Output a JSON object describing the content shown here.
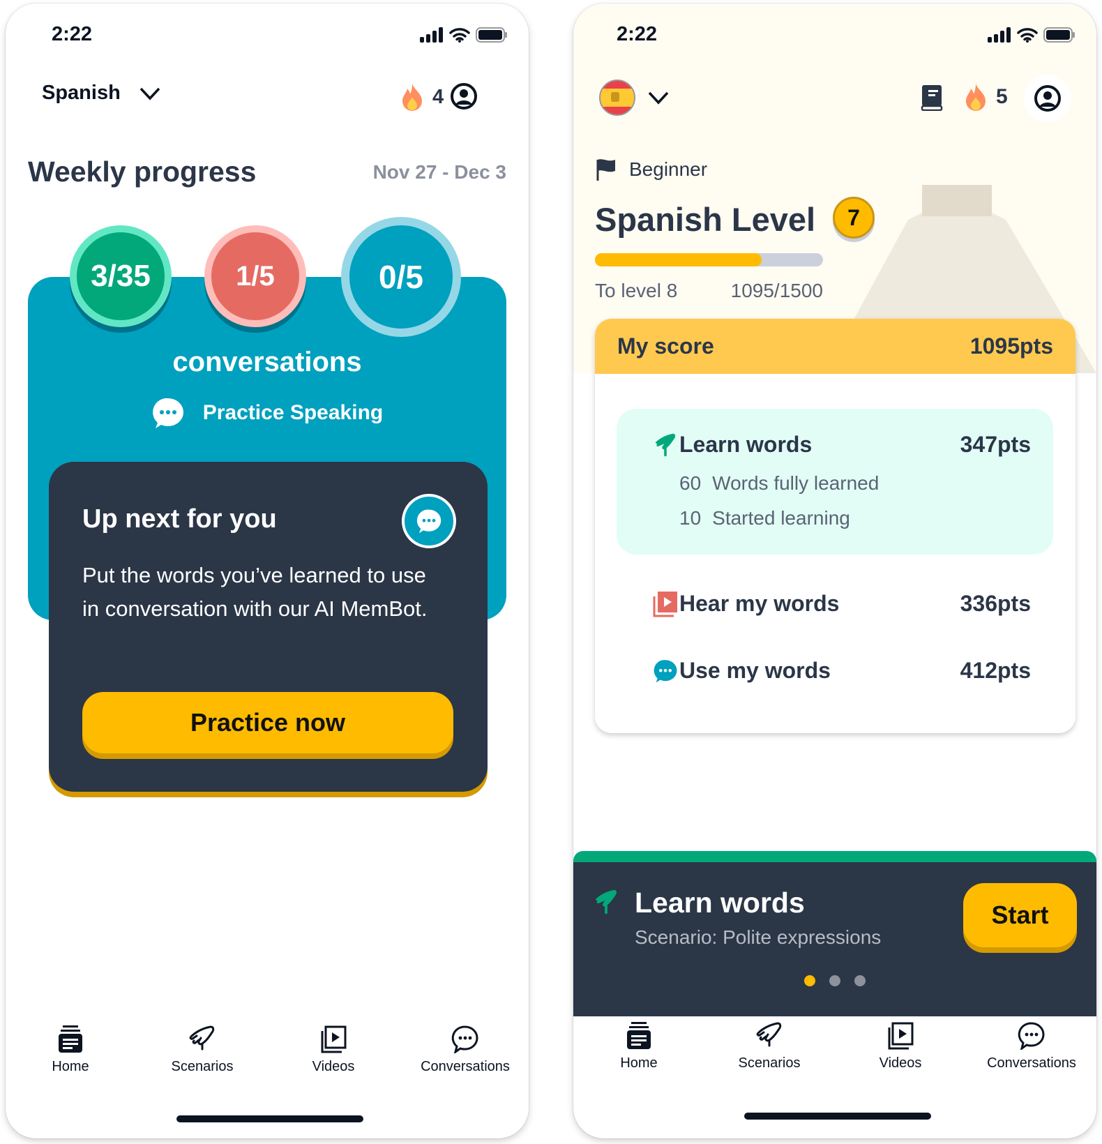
{
  "status": {
    "time": "2:22"
  },
  "left": {
    "language": "Spanish",
    "streak": "4",
    "title": "Weekly progress",
    "date_range": "Nov 27 - Dec 3",
    "circles": [
      {
        "value": "3/35",
        "color": "#03a87a"
      },
      {
        "value": "1/5",
        "color": "#e56b62"
      },
      {
        "value": "0/5",
        "color": "#00a0bf"
      }
    ],
    "circle_label": "conversations",
    "practice_label": "Practice Speaking",
    "up_next": {
      "title": "Up next for you",
      "body": "Put the words you’ve learned to use in conversation with our AI MemBot.",
      "button": "Practice now"
    }
  },
  "right": {
    "streak": "5",
    "difficulty": "Beginner",
    "level_title": "Spanish Level",
    "level": "7",
    "progress": {
      "label": "To level 8",
      "value": "1095/1500",
      "current": 1095,
      "target": 1500
    },
    "score": {
      "label": "My score",
      "value": "1095pts"
    },
    "learn": {
      "label": "Learn words",
      "pts": "347pts",
      "stats": [
        {
          "n": "60",
          "label": "Words fully learned"
        },
        {
          "n": "10",
          "label": "Started learning"
        }
      ]
    },
    "hear": {
      "label": "Hear my words",
      "pts": "336pts"
    },
    "use": {
      "label": "Use my words",
      "pts": "412pts"
    },
    "promo": {
      "title": "Learn words",
      "subtitle": "Scenario: Polite expressions",
      "button": "Start",
      "pages": 3,
      "active_page": 1
    }
  },
  "nav": [
    {
      "label": "Home",
      "icon": "home-icon"
    },
    {
      "label": "Scenarios",
      "icon": "scenarios-icon"
    },
    {
      "label": "Videos",
      "icon": "videos-icon"
    },
    {
      "label": "Conversations",
      "icon": "conversations-icon"
    }
  ],
  "colors": {
    "teal": "#00a0bf",
    "navy": "#2b3647",
    "yellow": "#ffbb00",
    "green": "#03a87a"
  }
}
